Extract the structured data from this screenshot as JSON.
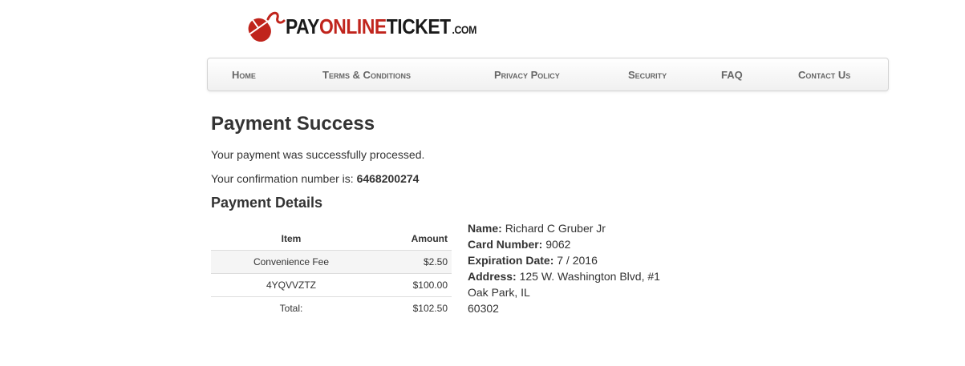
{
  "brand": {
    "logo_text_pay": "PAY",
    "logo_text_online": "ONLINE",
    "logo_text_ticket": "TICKET",
    "logo_text_com": ".COM",
    "brand_color": "#c0241c"
  },
  "nav": {
    "items": [
      {
        "label": "Home"
      },
      {
        "label": "Terms & Conditions"
      },
      {
        "label": "Privacy Policy"
      },
      {
        "label": "Security"
      },
      {
        "label": "FAQ"
      },
      {
        "label": "Contact Us"
      }
    ]
  },
  "main": {
    "title": "Payment Success",
    "success_message": "Your payment was successfully processed.",
    "confirmation_label": "Your confirmation number is:",
    "confirmation_number": "6468200274",
    "details_title": "Payment Details"
  },
  "table": {
    "headers": {
      "item": "Item",
      "amount": "Amount"
    },
    "rows": [
      {
        "item": "Convenience Fee",
        "amount": "$2.50"
      },
      {
        "item": "4YQVVZTZ",
        "amount": "$100.00"
      },
      {
        "item": "Total:",
        "amount": "$102.50"
      }
    ]
  },
  "payer": {
    "name_label": "Name:",
    "name": "Richard C Gruber Jr",
    "card_label": "Card Number:",
    "card": "9062",
    "exp_label": "Expiration Date:",
    "exp": "7 / 2016",
    "address_label": "Address:",
    "address_line1": "125 W. Washington Blvd, #1",
    "address_line2": "Oak Park, IL",
    "address_line3": "60302"
  }
}
